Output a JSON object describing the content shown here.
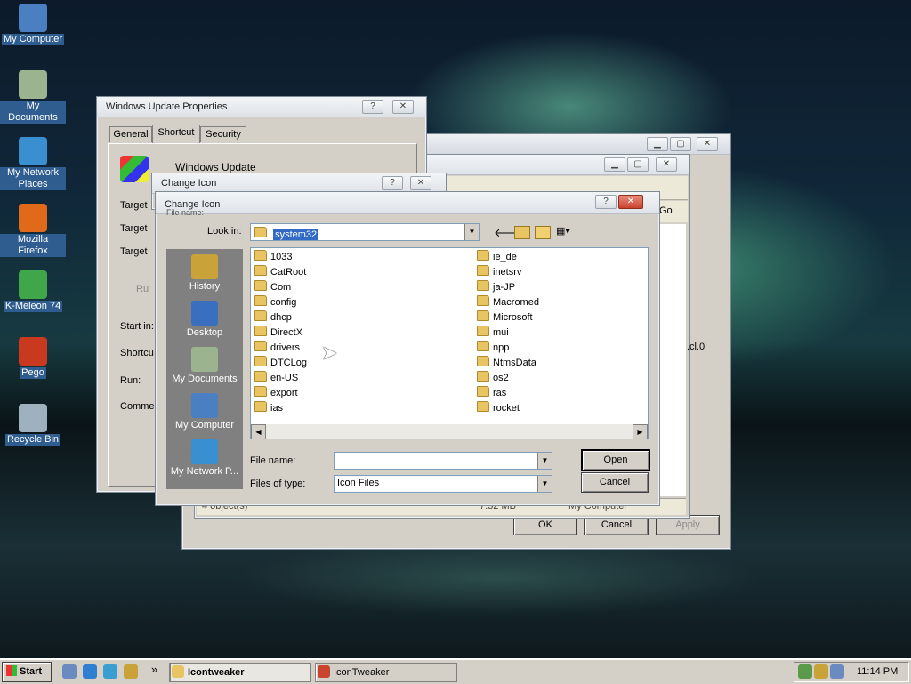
{
  "desktop": {
    "icons": [
      {
        "label": "My Computer",
        "icon": "computer-icon",
        "color": "#4a7fc1"
      },
      {
        "label": "My Documents",
        "icon": "documents-icon",
        "color": "#9bb38e"
      },
      {
        "label": "My Network Places",
        "icon": "network-icon",
        "color": "#3a8fd0"
      },
      {
        "label": "Mozilla Firefox",
        "icon": "firefox-icon",
        "color": "#e06a1a"
      },
      {
        "label": "K-Meleon 74",
        "icon": "kmeleon-icon",
        "color": "#3fa64a"
      },
      {
        "label": "Pego",
        "icon": "pego-icon",
        "color": "#c8391f"
      },
      {
        "label": "Recycle Bin",
        "icon": "recycle-bin-icon",
        "color": "#9fb0bf"
      }
    ]
  },
  "props_window": {
    "title": "Windows Update Properties",
    "help": "?",
    "close": "✕",
    "tabs": [
      "General",
      "Shortcut",
      "Security"
    ],
    "name": "Windows Update",
    "labels": [
      "Target",
      "Target",
      "Target",
      "Ru",
      "Start in:",
      "Shortcu",
      "Run:",
      "Commen"
    ]
  },
  "explorer_window": {
    "min": "▁",
    "max": "▢",
    "close": "✕",
    "status_items": "4 object(s)",
    "status_size": "7.32 MB",
    "status_loc": "My Computer",
    "ok": "OK",
    "cancel": "Cancel",
    "apply": "Apply",
    "go": "Go",
    "side_text": ".cl.0"
  },
  "change_icon_back": {
    "title": "Change Icon",
    "help": "?",
    "close": "✕"
  },
  "open_dialog": {
    "title": "Change Icon",
    "subtitle": "File name:",
    "help": "?",
    "close": "✕",
    "look_in_label": "Look in:",
    "look_in_value": "system32",
    "places": [
      {
        "label": "History",
        "icon": "history-icon"
      },
      {
        "label": "Desktop",
        "icon": "desktop-icon"
      },
      {
        "label": "My Documents",
        "icon": "documents-icon"
      },
      {
        "label": "My Computer",
        "icon": "computer-icon"
      },
      {
        "label": "My Network P...",
        "icon": "network-icon"
      }
    ],
    "folders_col1": [
      "1033",
      "CatRoot",
      "Com",
      "config",
      "dhcp",
      "DirectX",
      "drivers",
      "DTCLog",
      "en-US",
      "export",
      "ias"
    ],
    "folders_col2": [
      "ie_de",
      "inetsrv",
      "ja-JP",
      "Macromed",
      "Microsoft",
      "mui",
      "npp",
      "NtmsData",
      "os2",
      "ras",
      "rocket"
    ],
    "file_name_label": "File name:",
    "file_name_value": "",
    "files_of_type_label": "Files of type:",
    "files_of_type_value": "Icon Files",
    "open": "Open",
    "cancel": "Cancel"
  },
  "taskbar": {
    "start": "Start",
    "quicklaunch": [
      "show-desktop-icon",
      "ie-icon",
      "media-icon",
      "search-icon"
    ],
    "chevron": "»",
    "items": [
      {
        "label": "Icontweaker",
        "active": true
      },
      {
        "label": "IconTweaker",
        "active": false
      }
    ],
    "clock": "11:14 PM"
  }
}
